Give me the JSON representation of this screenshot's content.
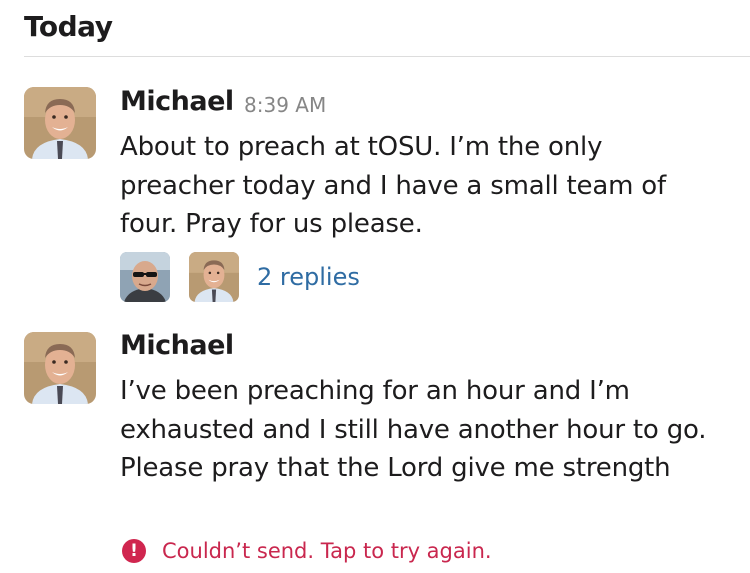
{
  "day_header": "Today",
  "messages": [
    {
      "author": "Michael",
      "time": "8:39 AM",
      "avatar": "michael-avatar",
      "text": "About to preach at tOSU. I’m the only preacher today and I have a small team of four. Pray for us please.",
      "thread": {
        "reply_avatars": [
          "sunglasses-user-avatar",
          "michael-avatar"
        ],
        "replies_label": "2 replies"
      }
    },
    {
      "author": "Michael",
      "avatar": "michael-avatar",
      "text": "I’ve been preaching for an hour and I’m exhausted and I still have another hour to go. Please pray that the Lord give me strength",
      "error": {
        "icon": "exclamation-icon",
        "label": "Couldn’t send. Tap to try again."
      }
    }
  ],
  "colors": {
    "link": "#2f6ca3",
    "error": "#c9274e",
    "timestamp": "#868686",
    "divider": "#dddddd"
  }
}
